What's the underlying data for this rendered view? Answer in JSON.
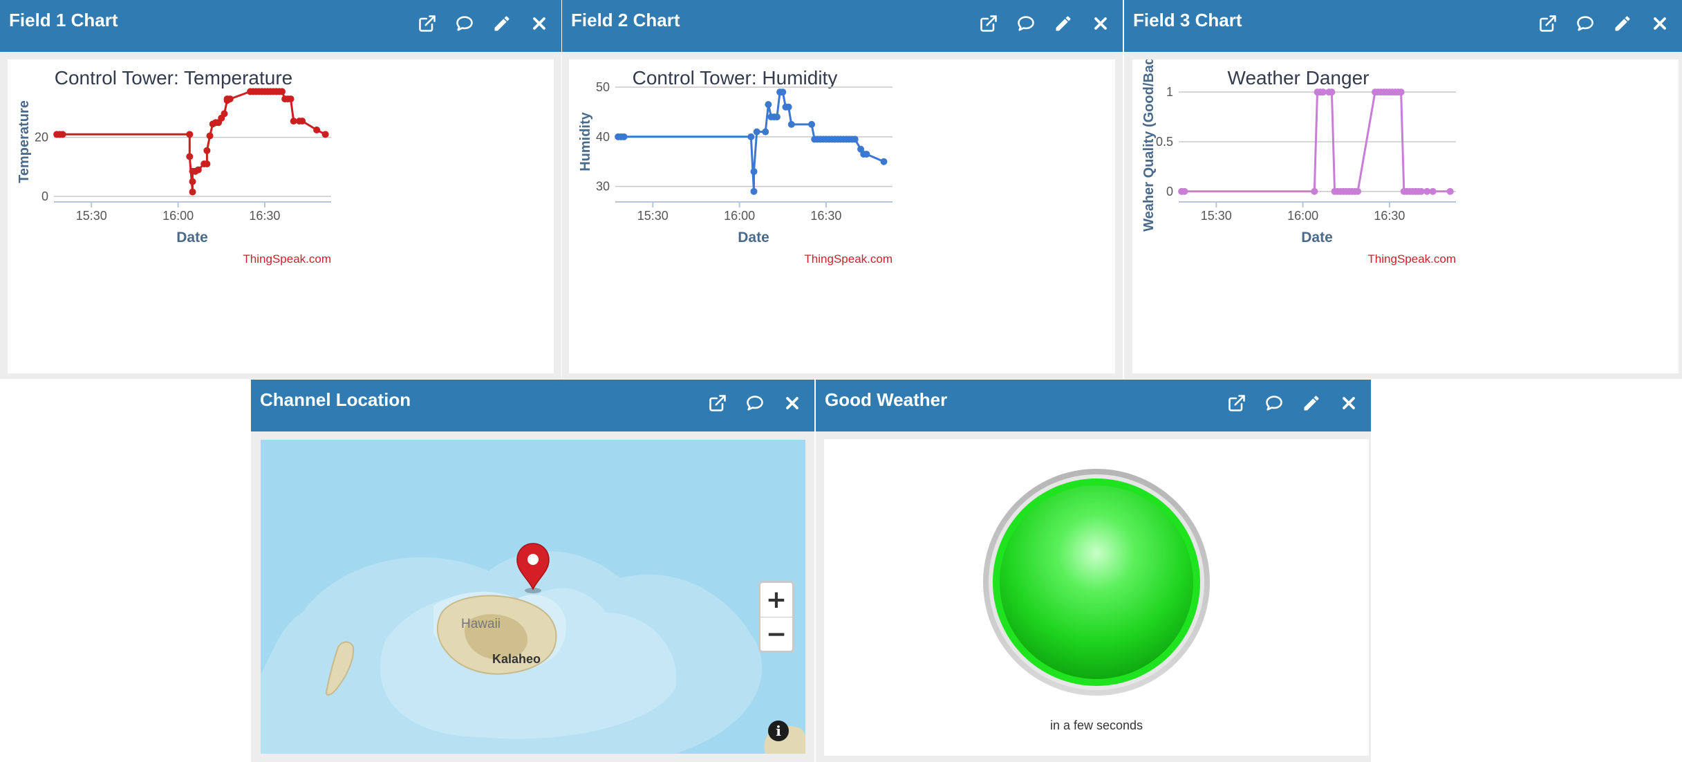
{
  "widgets": {
    "field1": {
      "title": "Field 1 Chart"
    },
    "field2": {
      "title": "Field 2 Chart"
    },
    "field3": {
      "title": "Field 3 Chart"
    },
    "location": {
      "title": "Channel Location"
    },
    "lamp": {
      "title": "Good Weather"
    }
  },
  "icons": {
    "popout": "external-link-icon",
    "comment": "comment-icon",
    "edit": "pencil-icon",
    "close": "close-icon"
  },
  "map": {
    "labels": [
      "Hawaii",
      "Kalaheo"
    ],
    "zoom_in": "+",
    "zoom_out": "−",
    "info": "i",
    "marker": "map-marker-icon"
  },
  "lamp": {
    "caption": "in a few seconds",
    "state": "on",
    "color": "#1fe31f"
  },
  "credit": "ThingSpeak.com",
  "chart_data": [
    {
      "type": "line",
      "title": "Control Tower: Temperature",
      "xlabel": "Date",
      "ylabel": "Temperature",
      "color": "#cc1f1f",
      "x_ticks": [
        "15:30",
        "16:00",
        "16:30"
      ],
      "y_ticks": [
        "0",
        "20"
      ],
      "xlim": [
        "15:17",
        "16:53"
      ],
      "ylim": [
        0,
        37
      ],
      "grid": true,
      "series": [
        {
          "x": [
            "15:18",
            "15:19",
            "15:20",
            "16:04",
            "16:04",
            "16:05",
            "16:05",
            "16:05",
            "16:06",
            "16:07",
            "16:09",
            "16:10",
            "16:10",
            "16:11",
            "16:12",
            "16:13",
            "16:14",
            "16:15",
            "16:16",
            "16:17",
            "16:17",
            "16:18",
            "16:25",
            "16:26",
            "16:27",
            "16:28",
            "16:29",
            "16:30",
            "16:31",
            "16:32",
            "16:33",
            "16:34",
            "16:35",
            "16:36",
            "16:37",
            "16:38",
            "16:39",
            "16:40",
            "16:42",
            "16:43",
            "16:48",
            "16:51"
          ],
          "y": [
            21,
            21,
            21,
            21,
            13.5,
            1.5,
            5,
            8.5,
            8.5,
            9,
            11,
            11,
            15.5,
            20.5,
            24.5,
            25,
            25,
            26.5,
            28,
            32.5,
            33,
            33,
            35.5,
            35.5,
            35.5,
            35.5,
            35.5,
            35.5,
            35.5,
            35.5,
            35.5,
            35.5,
            35.5,
            35.5,
            33,
            33,
            33,
            25.5,
            25.5,
            25.5,
            22.5,
            21
          ]
        }
      ]
    },
    {
      "type": "line",
      "title": "Control Tower: Humidity",
      "xlabel": "Date",
      "ylabel": "Humidity",
      "color": "#3b78cf",
      "x_ticks": [
        "15:30",
        "16:00",
        "16:30"
      ],
      "y_ticks": [
        "30",
        "40",
        "50"
      ],
      "xlim": [
        "15:17",
        "16:53"
      ],
      "ylim": [
        28,
        50
      ],
      "grid": true,
      "series": [
        {
          "x": [
            "15:18",
            "15:19",
            "15:20",
            "16:04",
            "16:05",
            "16:05",
            "16:06",
            "16:09",
            "16:10",
            "16:11",
            "16:12",
            "16:13",
            "16:14",
            "16:15",
            "16:16",
            "16:17",
            "16:18",
            "16:25",
            "16:26",
            "16:27",
            "16:28",
            "16:29",
            "16:30",
            "16:31",
            "16:32",
            "16:33",
            "16:34",
            "16:35",
            "16:36",
            "16:37",
            "16:38",
            "16:39",
            "16:40",
            "16:42",
            "16:43",
            "16:44",
            "16:50"
          ],
          "y": [
            40,
            40,
            40,
            40,
            29,
            33,
            41,
            41,
            46.5,
            44,
            44,
            44,
            49,
            49,
            46,
            46,
            42.5,
            42.5,
            39.5,
            39.5,
            39.5,
            39.5,
            39.5,
            39.5,
            39.5,
            39.5,
            39.5,
            39.5,
            39.5,
            39.5,
            39.5,
            39.5,
            39.5,
            37.5,
            36.5,
            36.5,
            35
          ]
        }
      ]
    },
    {
      "type": "line",
      "title": "Weather Danger",
      "xlabel": "Date",
      "ylabel": "Weaher Quality (Good/Bad)",
      "color": "#c87ed6",
      "x_ticks": [
        "15:30",
        "16:00",
        "16:30"
      ],
      "y_ticks": [
        "0",
        "0.5",
        "1"
      ],
      "xlim": [
        "15:17",
        "16:53"
      ],
      "ylim": [
        -0.05,
        1.05
      ],
      "grid": true,
      "series": [
        {
          "x": [
            "15:18",
            "15:19",
            "16:04",
            "16:05",
            "16:06",
            "16:07",
            "16:09",
            "16:10",
            "16:11",
            "16:12",
            "16:13",
            "16:14",
            "16:15",
            "16:16",
            "16:17",
            "16:18",
            "16:19",
            "16:25",
            "16:26",
            "16:27",
            "16:28",
            "16:29",
            "16:30",
            "16:31",
            "16:32",
            "16:33",
            "16:34",
            "16:35",
            "16:36",
            "16:37",
            "16:38",
            "16:39",
            "16:40",
            "16:41",
            "16:43",
            "16:45",
            "16:51"
          ],
          "y": [
            0,
            0,
            0,
            1,
            1,
            1,
            1,
            1,
            0,
            0,
            0,
            0,
            0,
            0,
            0,
            0,
            0,
            1,
            1,
            1,
            1,
            1,
            1,
            1,
            1,
            1,
            1,
            0,
            0,
            0,
            0,
            0,
            0,
            0,
            0,
            0,
            0
          ]
        }
      ]
    }
  ]
}
